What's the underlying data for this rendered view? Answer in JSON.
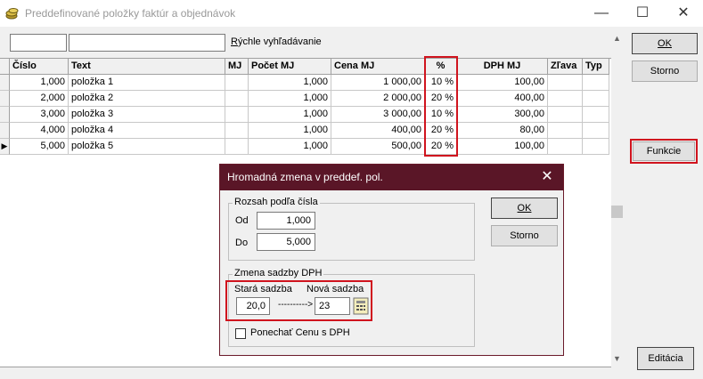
{
  "window": {
    "title": "Preddefinované položky faktúr a objednávok"
  },
  "search": {
    "label": "Rýchle vyhľadávanie",
    "field1_value": "",
    "field2_value": ""
  },
  "table": {
    "headers": [
      "Číslo",
      "Text",
      "MJ",
      "Počet MJ",
      "Cena MJ",
      "%",
      "DPH MJ",
      "Zľava",
      "Typ"
    ],
    "rows": [
      [
        "1,000",
        "položka 1",
        "",
        "1,000",
        "1 000,00",
        "10 %",
        "100,00",
        "",
        ""
      ],
      [
        "2,000",
        "položka 2",
        "",
        "1,000",
        "2 000,00",
        "20 %",
        "400,00",
        "",
        ""
      ],
      [
        "3,000",
        "položka 3",
        "",
        "1,000",
        "3 000,00",
        "10 %",
        "300,00",
        "",
        ""
      ],
      [
        "4,000",
        "položka 4",
        "",
        "1,000",
        "400,00",
        "20 %",
        "80,00",
        "",
        ""
      ],
      [
        "5,000",
        "položka 5",
        "",
        "1,000",
        "500,00",
        "20 %",
        "100,00",
        "",
        ""
      ]
    ],
    "current_row_marker": "▶"
  },
  "buttons": {
    "ok": "OK",
    "storno": "Storno",
    "funkcie": "Funkcie",
    "editacia": "Editácia"
  },
  "dialog": {
    "title": "Hromadná zmena v preddef. pol.",
    "range": {
      "legend": "Rozsah podľa čísla",
      "od_label": "Od",
      "od_value": "1,000",
      "do_label": "Do",
      "do_value": "5,000"
    },
    "vat": {
      "legend": "Zmena sadzby DPH",
      "old_label": "Stará sadzba",
      "old_value": "20,0",
      "arrow": "---------->",
      "new_label": "Nová sadzba",
      "new_value": "23"
    },
    "keep_price_label": "Ponechať Cenu s DPH",
    "keep_price_checked": false,
    "ok": "OK",
    "storno": "Storno"
  },
  "colors": {
    "highlight": "#d0141e",
    "dialog_title": "#5a1627"
  }
}
